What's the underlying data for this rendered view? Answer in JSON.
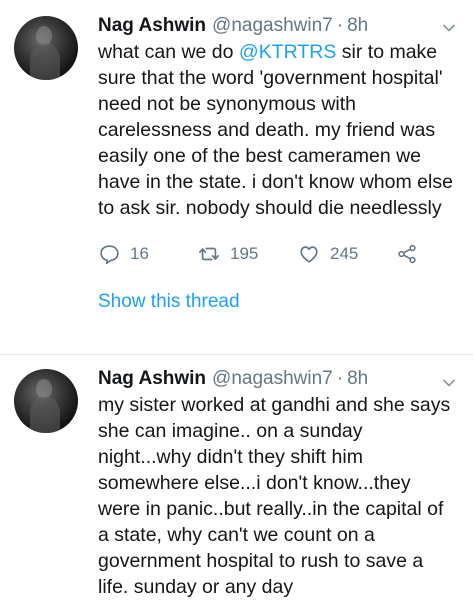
{
  "tweets": [
    {
      "name": "Nag Ashwin",
      "handle": "@nagashwin7",
      "time": "8h",
      "text_before": "what can we do ",
      "mention": "@KTRTRS",
      "text_after": " sir to make sure that the word 'government hospital' need not be synonymous with carelessness and death. my friend was easily one of the best cameramen we have in the state. i don't know whom else to ask sir. nobody should die needlessly",
      "replies": "16",
      "retweets": "195",
      "likes": "245",
      "thread_link": "Show this thread"
    },
    {
      "name": "Nag Ashwin",
      "handle": "@nagashwin7",
      "time": "8h",
      "text": "my sister worked at gandhi and she says she can imagine.. on a sunday night...why didn't they shift him somewhere else...i don't know...they were in panic..but really..in the capital of a state, why can't we count on a government hospital to rush to save a life. sunday or any day"
    }
  ],
  "separator": "·",
  "icons": {
    "reply": "reply-icon",
    "retweet": "retweet-icon",
    "like": "heart-icon",
    "share": "share-icon",
    "menu": "chevron-down-icon"
  },
  "colors": {
    "link": "#1da1f2",
    "muted": "#657786",
    "text": "#14171a"
  }
}
